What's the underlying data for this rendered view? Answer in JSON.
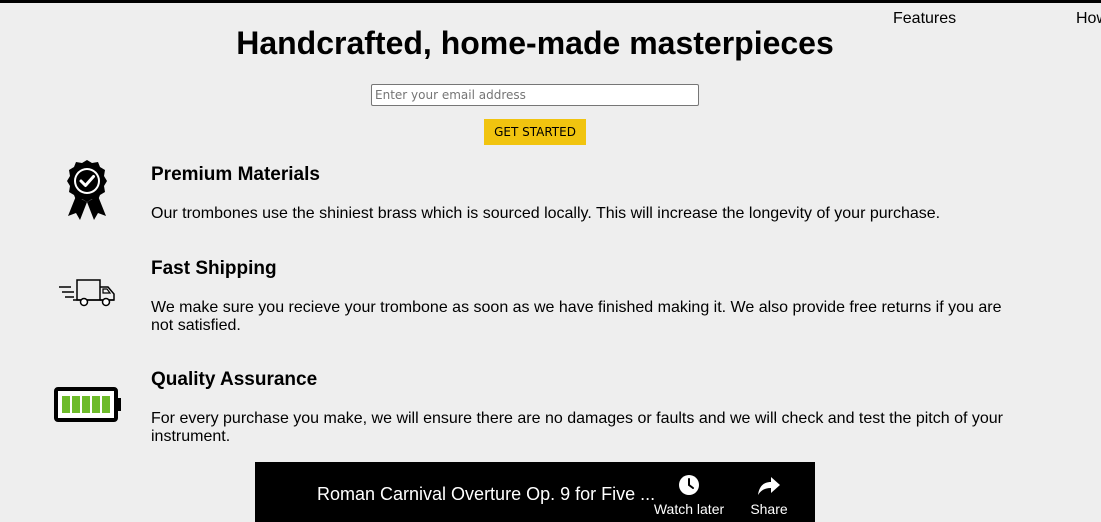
{
  "nav": {
    "features": "Features",
    "how": "How"
  },
  "hero": {
    "title": "Handcrafted, home-made masterpieces",
    "email_placeholder": "Enter your email address",
    "cta_label": "GET STARTED"
  },
  "features": [
    {
      "icon": "award-ribbon-icon",
      "title": "Premium Materials",
      "text": "Our trombones use the shiniest brass which is sourced locally. This will increase the longevity of your purchase."
    },
    {
      "icon": "delivery-truck-icon",
      "title": "Fast Shipping",
      "text": "We make sure you recieve your trombone as soon as we have finished making it. We also provide free returns if you are not satisfied."
    },
    {
      "icon": "battery-full-icon",
      "title": "Quality Assurance",
      "text": "For every purchase you make, we will ensure there are no damages or faults and we will check and test the pitch of your instrument."
    }
  ],
  "video": {
    "title": "Roman Carnival Overture Op. 9 for Five ...",
    "watch_later": "Watch later",
    "share": "Share"
  },
  "colors": {
    "background": "#eeeeee",
    "cta": "#f1c40f",
    "battery_green": "#6dbb2a",
    "video_bg": "#000000"
  }
}
